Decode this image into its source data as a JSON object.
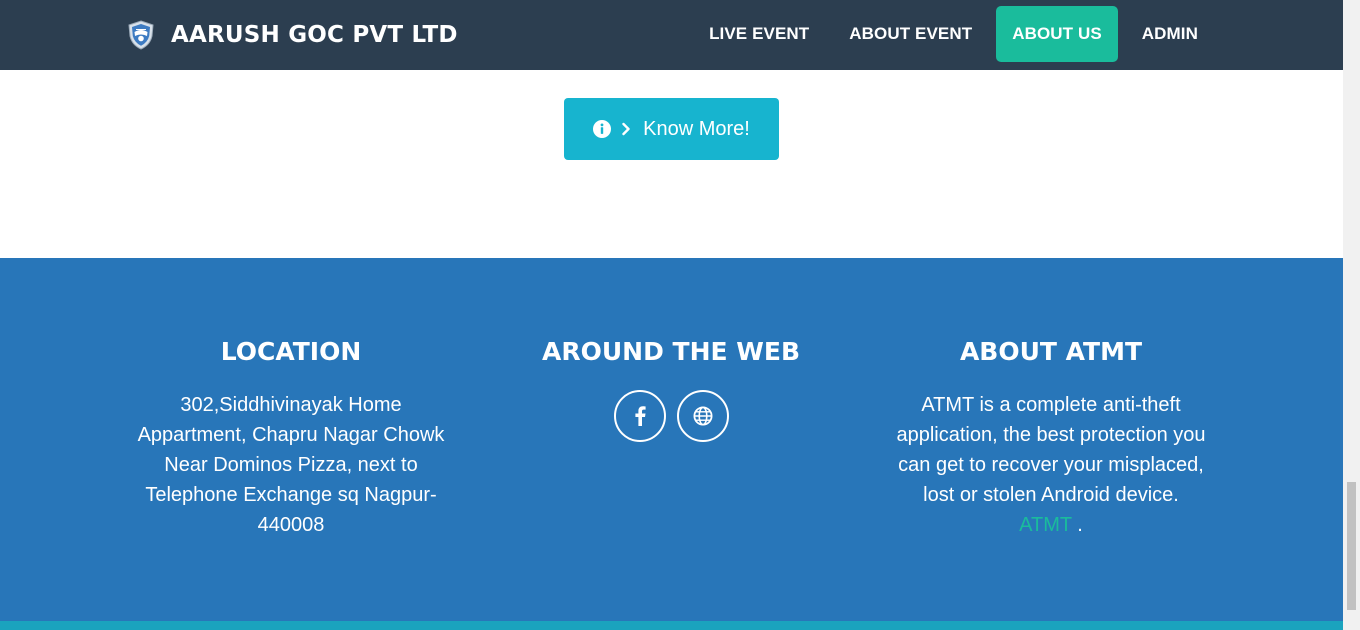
{
  "navbar": {
    "brand": {
      "name": "AARUSH GOC PVT LTD",
      "logo_icon": "shield-logo-icon"
    },
    "links": [
      {
        "label": "LIVE EVENT",
        "active": false
      },
      {
        "label": "ABOUT EVENT",
        "active": false
      },
      {
        "label": "ABOUT US",
        "active": true
      },
      {
        "label": "ADMIN",
        "active": false
      }
    ]
  },
  "cta": {
    "label": "Know More!",
    "icons": [
      "info-icon",
      "chevron-right-icon"
    ]
  },
  "footer": {
    "location": {
      "heading": "LOCATION",
      "address": "302,Siddhivinayak Home Appartment, Chapru Nagar Chowk Near Dominos Pizza, next to Telephone Exchange sq Nagpur-440008"
    },
    "web": {
      "heading": "AROUND THE WEB",
      "social": [
        "facebook-icon",
        "globe-icon"
      ]
    },
    "about": {
      "heading": "ABOUT ATMT",
      "text": "ATMT is a complete anti-theft application, the best protection you can get to recover your misplaced, lost or stolen Android device.",
      "link_label": "ATMT",
      "suffix": "."
    }
  },
  "colors": {
    "navbar_bg": "#2c3e50",
    "accent": "#1abc9c",
    "cta_bg": "#17b4cf",
    "footer_bg": "#2876b9",
    "footer_strip": "#1aa3be"
  }
}
